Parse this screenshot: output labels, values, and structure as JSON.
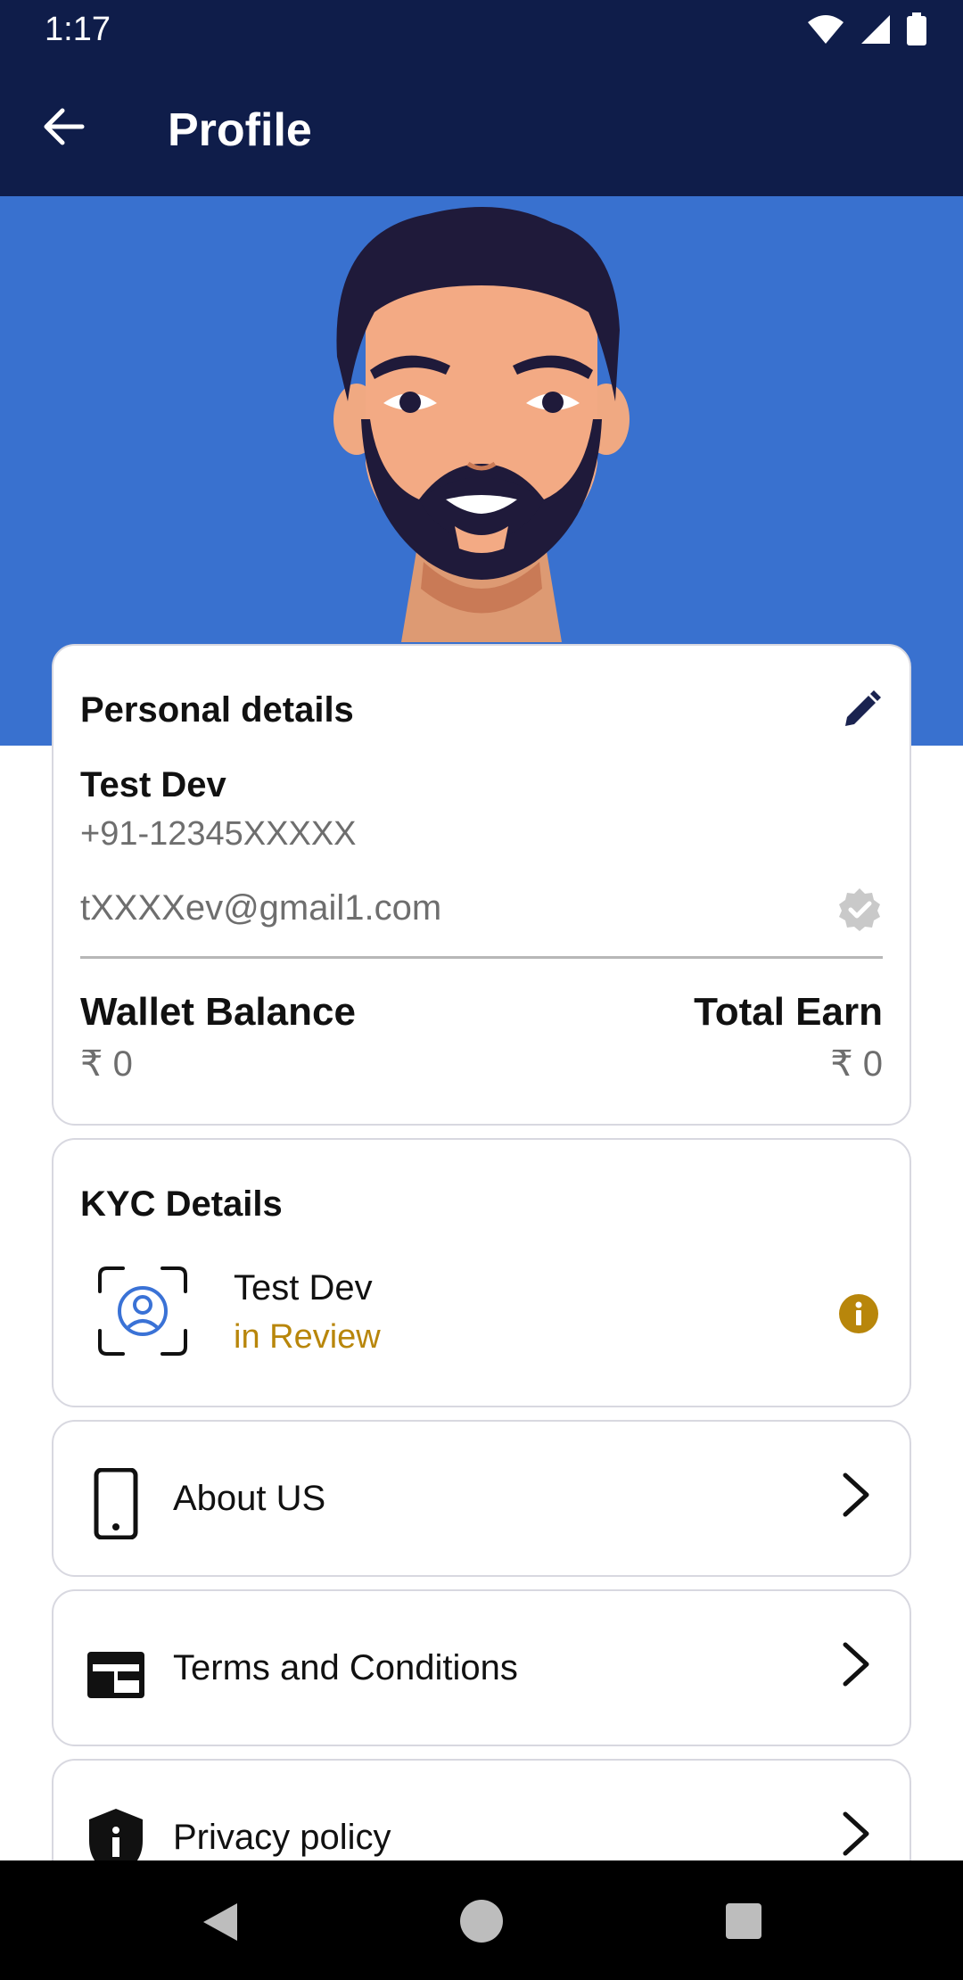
{
  "status_bar": {
    "time": "1:17"
  },
  "app_bar": {
    "title": "Profile"
  },
  "personal": {
    "section_title": "Personal details",
    "name": "Test Dev",
    "phone": "+91-12345XXXXX",
    "email": "tXXXXev@gmail1.com",
    "wallet_label": "Wallet Balance",
    "wallet_value": "₹ 0",
    "earn_label": "Total Earn",
    "earn_value": "₹ 0"
  },
  "kyc": {
    "section_title": "KYC Details",
    "name": "Test Dev",
    "status": "in Review"
  },
  "menu": [
    {
      "label": "About US",
      "icon": "phone-icon"
    },
    {
      "label": "Terms and Conditions",
      "icon": "terms-icon"
    },
    {
      "label": "Privacy policy",
      "icon": "shield-info-icon"
    }
  ],
  "colors": {
    "header": "#0f1d4a",
    "hero": "#3971cf",
    "review": "#b8860b"
  }
}
